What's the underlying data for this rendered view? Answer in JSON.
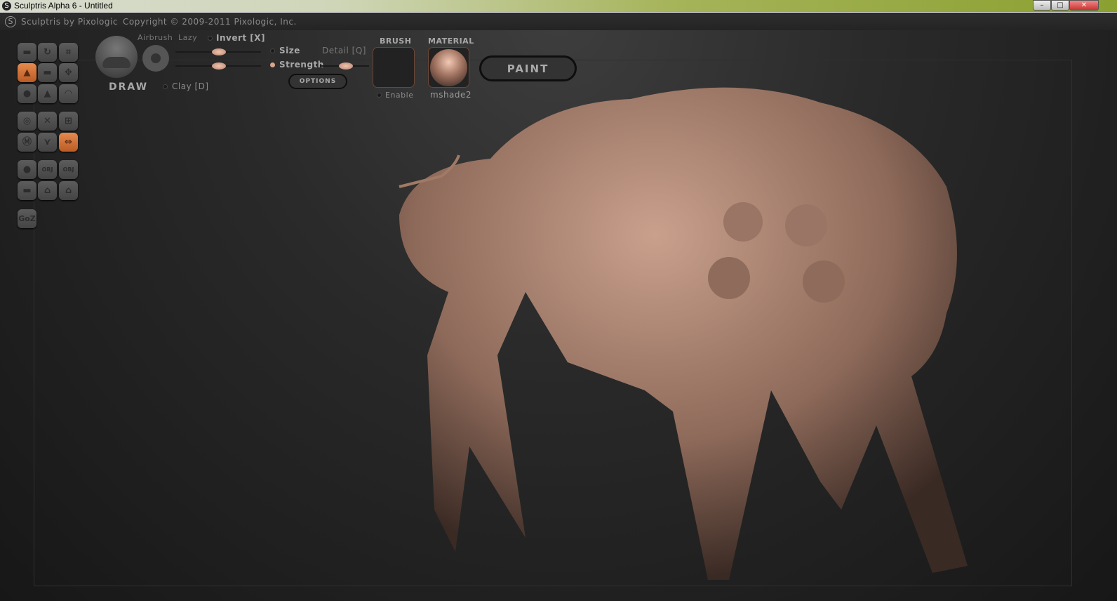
{
  "window": {
    "title": "Sculptris Alpha 6 - Untitled",
    "minimize": "–",
    "maximize": "□",
    "close": "✕"
  },
  "header": {
    "app_name": "Sculptris by Pixologic",
    "copyright": "Copyright © 2009-2011 Pixologic, Inc."
  },
  "toolbox": {
    "goz": "GoZ",
    "import_label": "OBJ",
    "export_label": "OBJ"
  },
  "brush_panel": {
    "tool_name": "DRAW",
    "airbrush": "Airbrush",
    "lazy": "Lazy",
    "invert": "Invert [X]",
    "size": "Size",
    "strength": "Strength",
    "detail": "Detail [Q]",
    "clay": "Clay [D]",
    "options": "OPTIONS",
    "size_value": 0.45,
    "strength_value": 0.45,
    "detail_value": 0.5
  },
  "brush": {
    "label": "BRUSH",
    "enable": "Enable"
  },
  "material": {
    "label": "MATERIAL",
    "name": "mshade2"
  },
  "paint_button": "PAINT",
  "colors": {
    "accent": "#d9803f",
    "model": "#a88270"
  }
}
